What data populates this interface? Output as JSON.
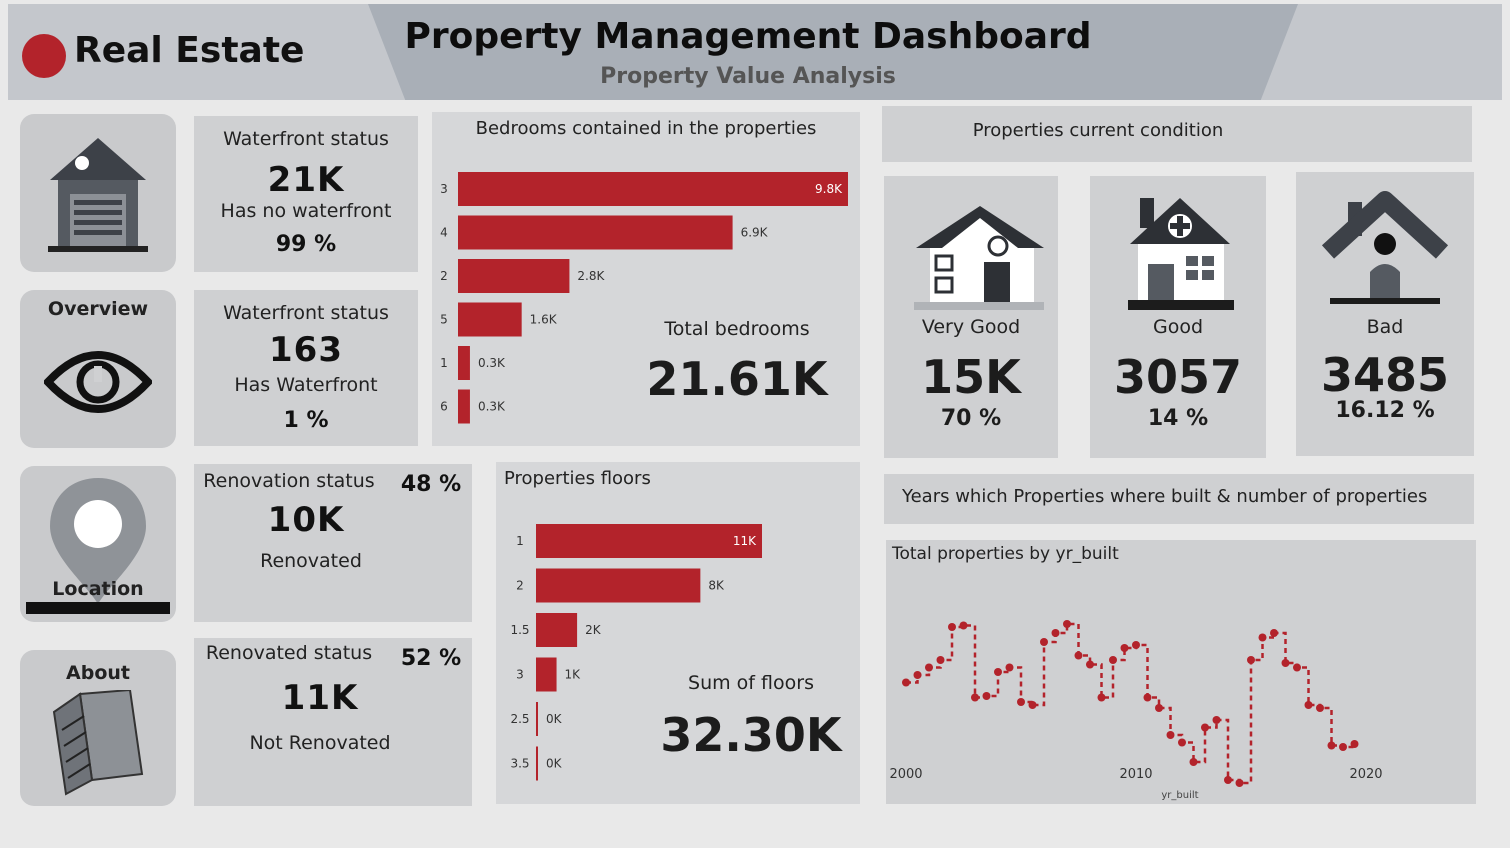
{
  "header": {
    "brand": "Real Estate",
    "title": "Property Management Dashboard",
    "subtitle": "Property Value Analysis"
  },
  "nav": {
    "overview": "Overview",
    "location": "Location",
    "about": "About"
  },
  "kpis": {
    "no_waterfront": {
      "title": "Waterfront status",
      "value": "21K",
      "label": "Has no waterfront",
      "pct": "99 %"
    },
    "waterfront": {
      "title": "Waterfront status",
      "value": "163",
      "label": "Has Waterfront",
      "pct": "1 %"
    },
    "renovated": {
      "title": "Renovation status",
      "value": "10K",
      "label": "Renovated",
      "pct": "48 %"
    },
    "not_renovated": {
      "title": "Renovated status",
      "value": "11K",
      "label": "Not Renovated",
      "pct": "52 %"
    }
  },
  "bedrooms": {
    "title": "Bedrooms contained in the properties",
    "total_label": "Total bedrooms",
    "total_value": "21.61K"
  },
  "floors": {
    "title": "Properties floors",
    "total_label": "Sum of floors",
    "total_value": "32.30K"
  },
  "condition": {
    "title": "Properties current condition",
    "items": [
      {
        "label": "Very Good",
        "value": "15K",
        "pct": "70 %"
      },
      {
        "label": "Good",
        "value": "3057",
        "pct": "14 %"
      },
      {
        "label": "Bad",
        "value": "3485",
        "pct": "16.12 %"
      }
    ]
  },
  "years": {
    "title": "Years which Properties where built & number of properties",
    "chart_title": "Total properties by yr_built",
    "xlabel": "yr_built"
  },
  "colors": {
    "accent": "#b3232b",
    "panel": "#cfd0d2"
  },
  "chart_data": [
    {
      "type": "bar",
      "orientation": "horizontal",
      "categories": [
        "3",
        "4",
        "2",
        "5",
        "1",
        "6"
      ],
      "values": [
        9800,
        6900,
        2800,
        1600,
        300,
        300
      ],
      "data_labels": [
        "9.8K",
        "6.9K",
        "2.8K",
        "1.6K",
        "0.3K",
        "0.3K"
      ],
      "xlim": [
        0,
        9800
      ]
    },
    {
      "type": "bar",
      "orientation": "horizontal",
      "categories": [
        "1",
        "2",
        "1.5",
        "3",
        "2.5",
        "3.5"
      ],
      "values": [
        11000,
        8000,
        2000,
        1000,
        0,
        0
      ],
      "data_labels": [
        "11K",
        "8K",
        "2K",
        "1K",
        "0K",
        "0K"
      ],
      "xlim": [
        0,
        11000
      ]
    },
    {
      "type": "line",
      "title": "Total properties by yr_built",
      "xlabel": "yr_built",
      "x_ticks": [
        "2000",
        "2010",
        "2020"
      ],
      "xlim": [
        2000,
        2020
      ],
      "ylim": [
        0,
        100
      ],
      "points": [
        [
          2000.0,
          45
        ],
        [
          2000.5,
          50
        ],
        [
          2001.0,
          55
        ],
        [
          2001.5,
          60
        ],
        [
          2002.0,
          82
        ],
        [
          2002.5,
          83
        ],
        [
          2003.0,
          35
        ],
        [
          2003.5,
          36
        ],
        [
          2004.0,
          52
        ],
        [
          2004.5,
          55
        ],
        [
          2005.0,
          32
        ],
        [
          2005.5,
          30
        ],
        [
          2006.0,
          72
        ],
        [
          2006.5,
          78
        ],
        [
          2007.0,
          84
        ],
        [
          2007.5,
          63
        ],
        [
          2008.0,
          57
        ],
        [
          2008.5,
          35
        ],
        [
          2009.0,
          60
        ],
        [
          2009.5,
          68
        ],
        [
          2010.0,
          70
        ],
        [
          2010.5,
          35
        ],
        [
          2011.0,
          28
        ],
        [
          2011.5,
          10
        ],
        [
          2012.0,
          5
        ],
        [
          2012.5,
          -8
        ],
        [
          2013.0,
          15
        ],
        [
          2013.5,
          20
        ],
        [
          2014.0,
          -20
        ],
        [
          2014.5,
          -22
        ],
        [
          2015.0,
          60
        ],
        [
          2015.5,
          75
        ],
        [
          2016.0,
          78
        ],
        [
          2016.5,
          58
        ],
        [
          2017.0,
          55
        ],
        [
          2017.5,
          30
        ],
        [
          2018.0,
          28
        ],
        [
          2018.5,
          3
        ],
        [
          2019.0,
          2
        ],
        [
          2019.5,
          4
        ]
      ]
    }
  ]
}
